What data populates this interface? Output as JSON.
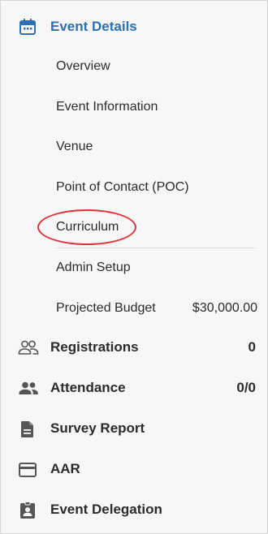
{
  "section": {
    "title": "Event Details"
  },
  "subitems": [
    {
      "label": "Overview"
    },
    {
      "label": "Event Information"
    },
    {
      "label": "Venue"
    },
    {
      "label": "Point of Contact (POC)"
    },
    {
      "label": "Curriculum"
    },
    {
      "label": "Admin Setup"
    },
    {
      "label": "Projected Budget",
      "value": "$30,000.00"
    }
  ],
  "nav": [
    {
      "label": "Registrations",
      "count": "0",
      "icon": "people-outline-icon"
    },
    {
      "label": "Attendance",
      "count": "0/0",
      "icon": "people-filled-icon"
    },
    {
      "label": "Survey Report",
      "icon": "document-icon"
    },
    {
      "label": "AAR",
      "icon": "card-icon"
    },
    {
      "label": "Event Delegation",
      "icon": "clipboard-badge-icon"
    }
  ],
  "colors": {
    "accent": "#2f6fb3",
    "highlight": "#e0313c",
    "text": "#2b2b2b",
    "icon": "#555555"
  }
}
